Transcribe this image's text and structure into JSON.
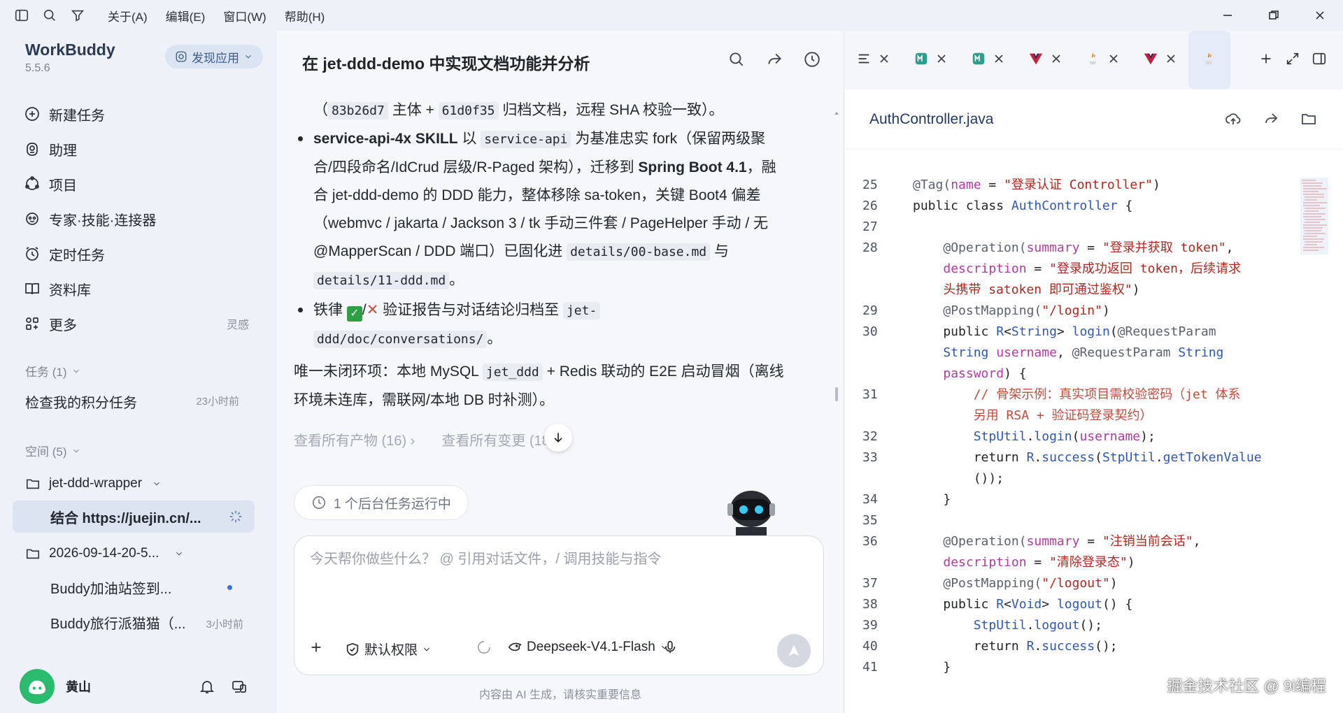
{
  "titlebar": {
    "menus": [
      "关于(A)",
      "编辑(E)",
      "窗口(W)",
      "帮助(H)"
    ]
  },
  "sidebar": {
    "brand_name": "WorkBuddy",
    "brand_version": "5.5.6",
    "discover_label": "发现应用",
    "nav": [
      {
        "label": "新建任务",
        "icon": "plus-circle-icon"
      },
      {
        "label": "助理",
        "icon": "assistant-icon"
      },
      {
        "label": "项目",
        "icon": "project-icon"
      },
      {
        "label": "专家·技能·连接器",
        "icon": "expert-icon"
      },
      {
        "label": "定时任务",
        "icon": "alarm-icon"
      },
      {
        "label": "资料库",
        "icon": "book-icon"
      },
      {
        "label": "更多",
        "icon": "grid-icon",
        "extra": "灵感"
      }
    ],
    "tasks_head": "任务 (1)",
    "task": {
      "title": "检查我的积分任务",
      "time": "23小时前"
    },
    "spaces_head": "空间 (5)",
    "ws1": "jet-ddd-wrapper",
    "ws1_sub": "结合 https://juejin.cn/...",
    "ws2": "2026-09-14-20-5...",
    "ws2_sub1": "Buddy加油站签到...",
    "ws2_sub2": "Buddy旅行派猫猫（...",
    "ws2_sub2_time": "3小时前",
    "user_name": "黄山"
  },
  "chat": {
    "title": "在 jet-ddd-demo 中实现文档功能并分析",
    "line1_pre": "（",
    "line1_c1": "83b26d7",
    "line1_mid": " 主体 + ",
    "line1_c2": "61d0f35",
    "line1_post": " 归档文档，远程 SHA 校验一致）。",
    "b1_bold": "service-api-4x SKILL",
    "b1_t1": " 以 ",
    "b1_c1": "service-api",
    "b1_t2": " 为基准忠实 fork（保留两级聚",
    "b1_l2_t1": "合/四段命名/IdCrud 层级/R-Paged 架构），迁移到 ",
    "b1_l2_bold": "Spring Boot 4.1",
    "b1_l2_t2": "，融",
    "b1_l3": "合 jet-ddd-demo 的 DDD 能力，整体移除 sa-token，关键 Boot4 偏差",
    "b1_l4": "（webmvc / jakarta / Jackson 3 / tk 手动三件套 / PageHelper 手动 / 无",
    "b1_l5_t1": "@MapperScan / DDD 端口）已固化进 ",
    "b1_l5_c1": "details/00-base.md",
    "b1_l5_t2": " 与",
    "b1_l6_c1": "details/11-ddd.md",
    "b1_l6_t2": "。",
    "b2_t1": "铁律 ",
    "b2_check": "✓",
    "b2_slash": "/",
    "b2_x": "✕",
    "b2_t2": " 验证报告与对话结论归档至 ",
    "b2_c1": "jet-",
    "b2_l2_c1": "ddd/doc/conversations/",
    "b2_l2_t2": "。",
    "p_l1_t1": "唯一未闭环项：本地 MySQL ",
    "p_l1_c1": "jet_ddd",
    "p_l1_t2": " + Redis 联动的 E2E 启动冒烟（离线",
    "p_l2": "环境未连库，需联网/本地 DB 时补测）。",
    "link1": "查看所有产物 (16) ›",
    "link2": "查看所有变更 (18) ›",
    "bg_task": "1 个后台任务运行中",
    "composer_placeholder": "今天帮你做些什么？ @ 引用对话文件，/ 调用技能与指令",
    "permission": "默认权限",
    "model": "Deepseek-V4.1-Flash",
    "disclaimer": "内容由 AI 生成，请核实重要信息"
  },
  "editor": {
    "file_name": "AuthController.java",
    "tabs": [
      {
        "icon": "list-icon"
      },
      {
        "icon": "markdown-icon"
      },
      {
        "icon": "markdown-icon"
      },
      {
        "icon": "vue-icon"
      },
      {
        "icon": "java-icon"
      },
      {
        "icon": "vue-icon"
      },
      {
        "icon": "java-icon"
      }
    ],
    "code_lines": [
      {
        "n": "25",
        "html": "<span class='tok-ann'>@Tag(</span><span class='tok-attr'>name</span> = <span class='tok-str'>\"登录认证 Controller\"</span>)"
      },
      {
        "n": "26",
        "html": "<span class='tok-key'>public class </span><span class='tok-type'>AuthController</span> {"
      },
      {
        "n": "27",
        "html": ""
      },
      {
        "n": "28",
        "html": "    <span class='tok-ann'>@Operation(</span><span class='tok-attr'>summary</span> = <span class='tok-str'>\"登录并获取 token\"</span>,"
      },
      {
        "n": "",
        "html": "    <span class='tok-attr'>description</span> = <span class='tok-str'>\"登录成功返回 token，后续请求</span>"
      },
      {
        "n": "",
        "html": "    <span class='tok-str'>头携带 satoken 即可通过鉴权\"</span>)"
      },
      {
        "n": "29",
        "html": "    <span class='tok-ann'>@PostMapping(</span><span class='tok-str'>\"/login\"</span>)"
      },
      {
        "n": "30",
        "html": "    public <span class='tok-type'>R</span>&lt;<span class='tok-type'>String</span>&gt; <span class='tok-fn'>login</span>(<span class='tok-ann'>@RequestParam</span>"
      },
      {
        "n": "",
        "html": "    <span class='tok-type'>String</span> <span class='tok-attr'>username</span>, <span class='tok-ann'>@RequestParam</span> <span class='tok-type'>String</span>"
      },
      {
        "n": "",
        "html": "    <span class='tok-attr'>password</span>) {"
      },
      {
        "n": "31",
        "html": "        <span class='tok-cmt'>// 骨架示例：真实项目需校验密码（jet 体系</span>"
      },
      {
        "n": "",
        "html": "        <span class='tok-cmt'>另用 RSA + 验证码登录契约）</span>"
      },
      {
        "n": "32",
        "html": "        <span class='tok-type'>StpUtil</span>.<span class='tok-fn'>login</span>(<span class='tok-attr'>username</span>);"
      },
      {
        "n": "33",
        "html": "        return <span class='tok-type'>R</span>.<span class='tok-fn'>success</span>(<span class='tok-type'>StpUtil</span>.<span class='tok-fn'>getTokenValue</span>"
      },
      {
        "n": "",
        "html": "        ());"
      },
      {
        "n": "34",
        "html": "    }"
      },
      {
        "n": "35",
        "html": ""
      },
      {
        "n": "36",
        "html": "    <span class='tok-ann'>@Operation(</span><span class='tok-attr'>summary</span> = <span class='tok-str'>\"注销当前会话\"</span>,"
      },
      {
        "n": "",
        "html": "    <span class='tok-attr'>description</span> = <span class='tok-str'>\"清除登录态\"</span>)"
      },
      {
        "n": "37",
        "html": "    <span class='tok-ann'>@PostMapping(</span><span class='tok-str'>\"/logout\"</span>)"
      },
      {
        "n": "38",
        "html": "    public <span class='tok-type'>R</span>&lt;<span class='tok-type'>Void</span>&gt; <span class='tok-fn'>logout</span>() {"
      },
      {
        "n": "39",
        "html": "        <span class='tok-type'>StpUtil</span>.<span class='tok-fn'>logout</span>();"
      },
      {
        "n": "40",
        "html": "        return <span class='tok-type'>R</span>.<span class='tok-fn'>success</span>();"
      },
      {
        "n": "41",
        "html": "    }"
      }
    ]
  },
  "watermark": "掘金技术社区 @ 9i编程"
}
